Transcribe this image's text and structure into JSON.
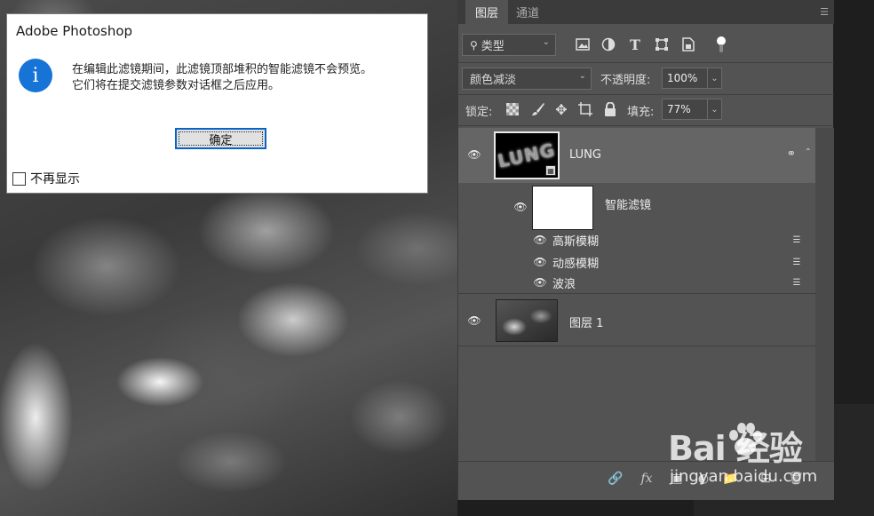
{
  "dialog": {
    "title": "Adobe Photoshop",
    "message_line1": "在编辑此滤镜期间，此滤镜顶部堆积的智能滤镜不会预览。",
    "message_line2": "它们将在提交滤镜参数对话框之后应用。",
    "ok_label": "确定",
    "dont_show_label": "不再显示",
    "dont_show_checked": false
  },
  "panel": {
    "tabs": [
      {
        "label": "图层",
        "active": true
      },
      {
        "label": "通道",
        "active": false
      }
    ],
    "filter": {
      "kind_label": "类型",
      "icons": [
        "image-filter-icon",
        "adjustment-filter-icon",
        "type-filter-icon",
        "shape-filter-icon",
        "smart-object-filter-icon"
      ]
    },
    "blend_mode": "颜色减淡",
    "opacity_label": "不透明度:",
    "opacity_value": "100%",
    "lock_label": "锁定:",
    "fill_label": "填充:",
    "fill_value": "77%",
    "layers": {
      "lung": {
        "name": "LUNG",
        "thumb_text": "LUNG"
      },
      "smart_filters_label": "智能滤镜",
      "filters": [
        {
          "name": "高斯模糊"
        },
        {
          "name": "动感模糊"
        },
        {
          "name": "波浪"
        }
      ],
      "layer1": {
        "name": "图层 1"
      }
    },
    "footer_fx": "fx"
  },
  "watermark": {
    "logo_text": "Bai  经验",
    "url": "jingyan.baidu.com"
  }
}
